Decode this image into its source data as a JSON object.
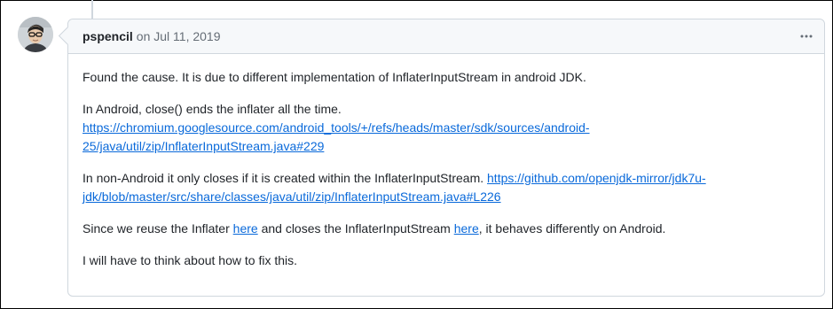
{
  "comment": {
    "author": "pspencil",
    "date": "on Jul 11, 2019",
    "menu_icon": "kebab-horizontal-icon",
    "p1": "Found the cause. It is due to different implementation of InflaterInputStream in android JDK.",
    "p2_text": "In Android, close() ends the inflater all the time.",
    "p2_link_line1": "https://chromium.googlesource.com/android_tools/+/refs/heads/master/sdk/sources/android-",
    "p2_link_line2": "25/java/util/zip/InflaterInputStream.java#229",
    "p3_text": "In non-Android it only closes if it is created within the InflaterInputStream.",
    "p3_link_line1": "https://github.com/openjdk-mirror/jdk7u-",
    "p3_link_line2": "jdk/blob/master/src/share/classes/java/util/zip/InflaterInputStream.java#L226",
    "p4_part1": "Since we reuse the Inflater",
    "p4_link1": "here",
    "p4_part2": "and closes the InflaterInputStream",
    "p4_link2": "here",
    "p4_part3": ", it behaves differently on Android.",
    "p5": "I will have to think about how to fix this."
  }
}
